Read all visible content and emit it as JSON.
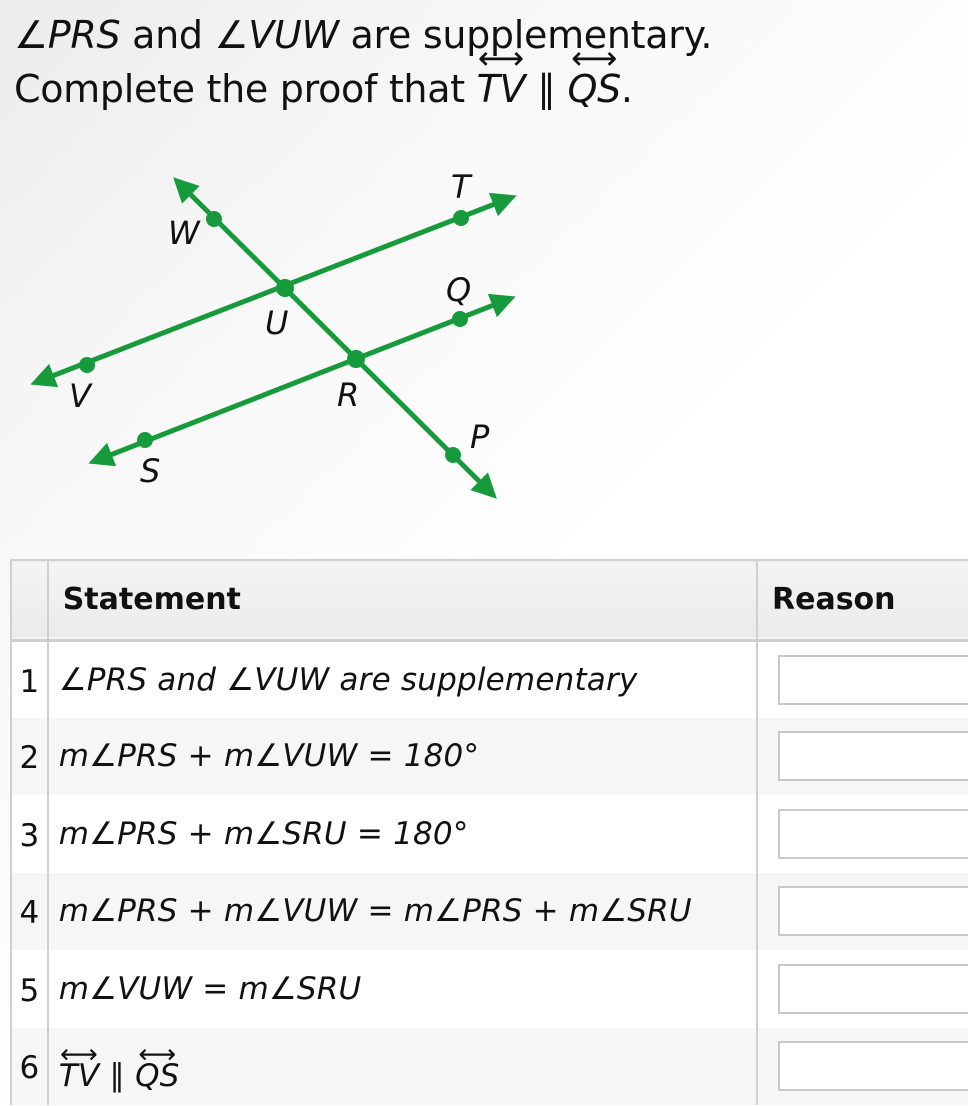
{
  "prompt": {
    "line1": {
      "angle1": "∠PRS",
      "conj": " and ",
      "angle2": "∠VUW",
      "rest": " are supplementary."
    },
    "line2": {
      "text": "Complete the proof that ",
      "line_a": "TV",
      "parallel": " ∥ ",
      "line_b": "QS",
      "end": "."
    },
    "line_arrow": "⟷"
  },
  "diagram": {
    "color": "#179a3c",
    "labels": {
      "T": "T",
      "W": "W",
      "Q": "Q",
      "U": "U",
      "V": "V",
      "R": "R",
      "S": "S",
      "P": "P"
    }
  },
  "table": {
    "headers": {
      "number": "",
      "statement": "Statement",
      "reason": "Reason"
    },
    "rows": [
      {
        "num": "1",
        "statement": "∠PRS and ∠VUW are supplementary",
        "reason": ""
      },
      {
        "num": "2",
        "statement": "m∠PRS + m∠VUW = 180°",
        "reason": ""
      },
      {
        "num": "3",
        "statement": "m∠PRS + m∠SRU = 180°",
        "reason": ""
      },
      {
        "num": "4",
        "statement": "m∠PRS + m∠VUW = m∠PRS + m∠SRU",
        "reason": ""
      },
      {
        "num": "5",
        "statement": "m∠VUW = m∠SRU",
        "reason": ""
      },
      {
        "num": "6",
        "statement": "TV ∥ QS",
        "reason": ""
      }
    ],
    "row6_parts": {
      "a": "TV",
      "par": " ∥ ",
      "b": "QS"
    }
  }
}
